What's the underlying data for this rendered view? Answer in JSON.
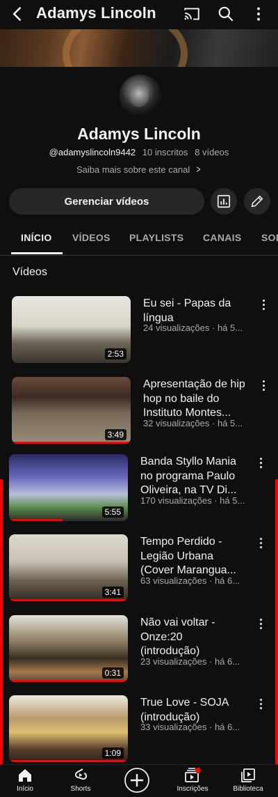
{
  "header": {
    "title": "Adamys Lincoln"
  },
  "channel": {
    "name": "Adamys Lincoln",
    "handle": "@adamyslincoln9442",
    "subscribers": "10 inscritos",
    "video_count": "8 vídeos",
    "about_link": "Saiba mais sobre este canal",
    "manage_button": "Gerenciar vídeos"
  },
  "tabs": [
    {
      "label": "INÍCIO",
      "active": true
    },
    {
      "label": "VÍDEOS"
    },
    {
      "label": "PLAYLISTS"
    },
    {
      "label": "CANAIS"
    },
    {
      "label": "SOBRE"
    }
  ],
  "section": {
    "title": "Vídeos"
  },
  "videos": [
    {
      "title": "Eu sei - Papas da língua",
      "meta": "24 visualizações · há 5...",
      "duration": "2:53",
      "progress": 0
    },
    {
      "title": "Apresentação de hip hop no baile do Instituto Montes...",
      "meta": "32 visualizações · há 5...",
      "duration": "3:49",
      "progress": 1.0
    },
    {
      "title": "Banda Styllo Mania no programa Paulo Oliveira, na TV Di...",
      "meta": "170 visualizações · há 5...",
      "duration": "5:55",
      "progress": 0.45
    },
    {
      "title": "Tempo Perdido - Legião Urbana (Cover Marangua...",
      "meta": "63 visualizações · há 6...",
      "duration": "3:41",
      "progress": 1.0
    },
    {
      "title": "Não vai voltar - Onze:20 (introdução)",
      "meta": "23 visualizações · há 6...",
      "duration": "0:31",
      "progress": 1.0
    },
    {
      "title": "True Love - SOJA (introdução)",
      "meta": "33 visualizações · há 6...",
      "duration": "1:09",
      "progress": 1.0
    }
  ],
  "bottom_nav": {
    "home": "Início",
    "shorts": "Shorts",
    "subscriptions": "Inscrições",
    "library": "Biblioteca"
  },
  "colors": {
    "background": "#0f0f0f",
    "accent": "#ff0000",
    "secondary_text": "#aaaaaa",
    "chip": "#272727"
  }
}
